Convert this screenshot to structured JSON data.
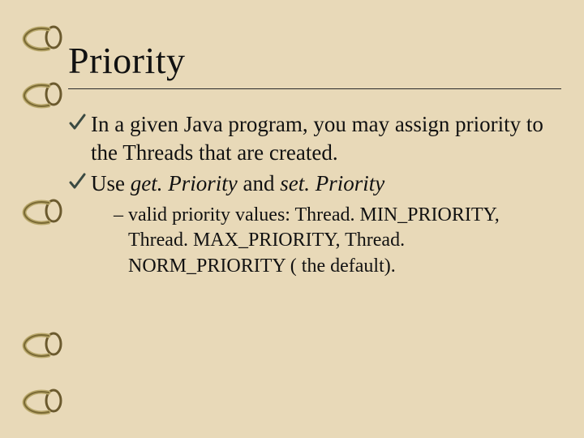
{
  "slide": {
    "title": "Priority",
    "bullets": [
      {
        "text": "In a given Java program, you may assign priority to the Threads that are created."
      },
      {
        "prefix": "Use ",
        "em1": "get. Priority",
        "mid": " and ",
        "em2": "set. Priority",
        "sub": "valid priority values: Thread. MIN_PRIORITY, Thread. MAX_PRIORITY, Thread. NORM_PRIORITY ( the default)."
      }
    ]
  }
}
